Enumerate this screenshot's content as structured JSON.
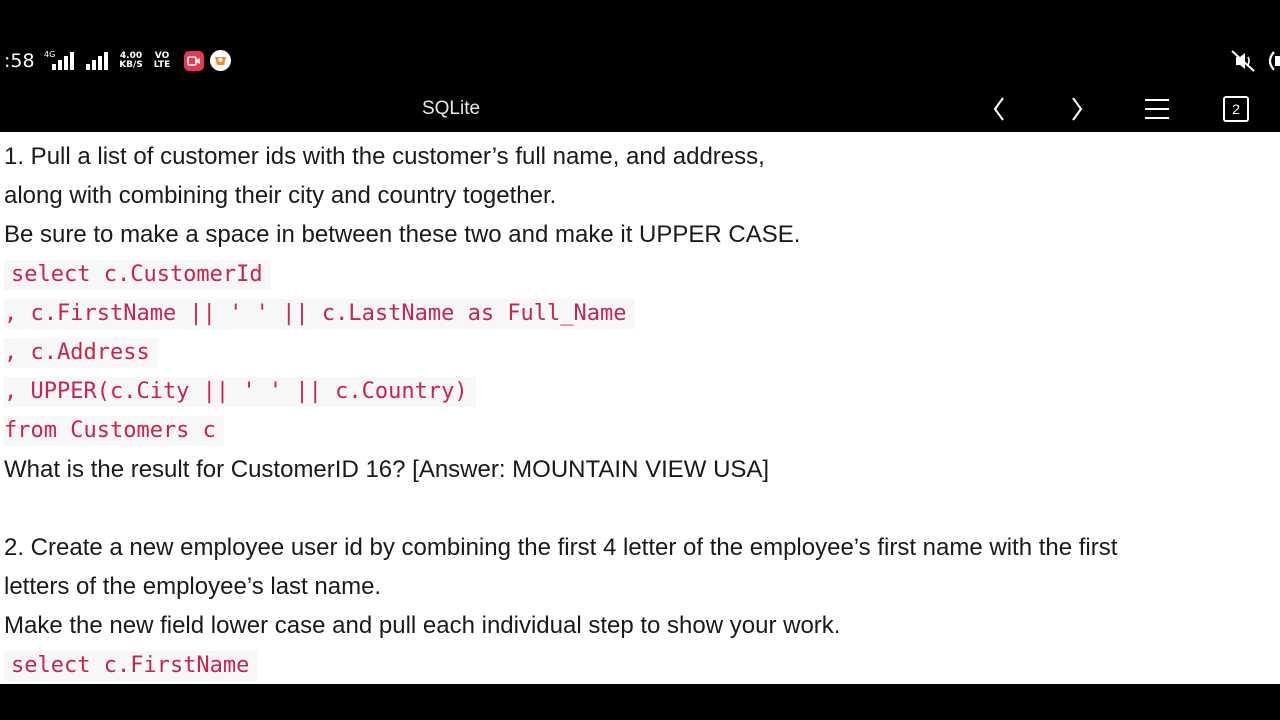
{
  "status": {
    "time": ":58",
    "network_type": "4G",
    "speed": [
      "4.00",
      "KB/S"
    ],
    "volte": [
      "VO",
      "LTE"
    ]
  },
  "toolbar": {
    "title": "SQLite",
    "tab_count": "2"
  },
  "content": {
    "q1": {
      "lines": [
        "1. Pull a list of customer ids with the customer’s full name, and address,",
        "along with combining their city and country together.",
        "Be sure to make a space in between these two and make it UPPER CASE."
      ],
      "code": [
        "select c.CustomerId",
        ", c.FirstName || ' ' || c.LastName as Full_Name",
        ", c.Address",
        ", UPPER(c.City || ' ' || c.Country)",
        "from Customers c"
      ],
      "result": "What is the result for CustomerID 16? [Answer: MOUNTAIN VIEW USA]"
    },
    "q2": {
      "lines": [
        "2. Create a new employee user id by combining the first 4 letter of the employee’s first name with the first",
        "letters of the employee’s last name.",
        "Make the new field lower case and pull each individual step to show your work."
      ],
      "code": [
        "select c.FirstName"
      ]
    }
  },
  "colors": {
    "code_text": "#c7254e",
    "code_bg": "#f7f7f7",
    "body_text": "#1a1a1a",
    "bar_bg": "#000000"
  }
}
